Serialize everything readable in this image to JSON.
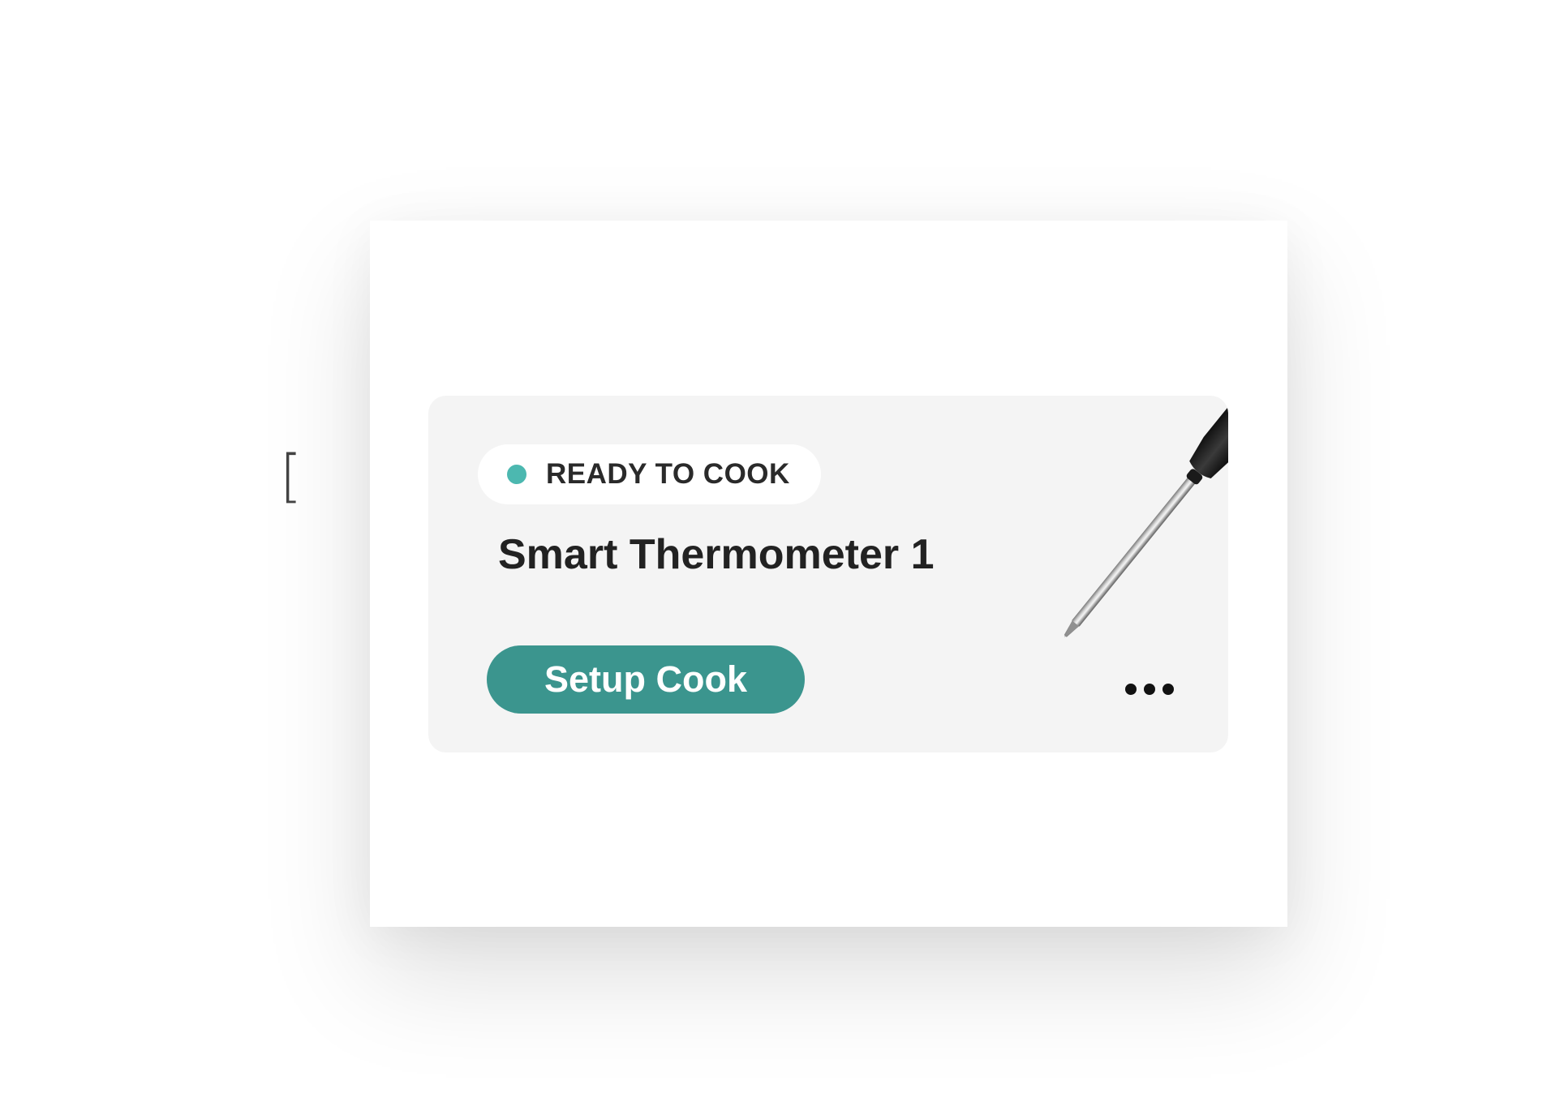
{
  "device_card": {
    "status_label": "READY TO COOK",
    "status_color": "#4cb8b0",
    "device_name": "Smart Thermometer 1",
    "setup_button_label": "Setup Cook",
    "button_color": "#3b958e",
    "more_icon": "more-horizontal-icon",
    "image": "thermometer-probe"
  },
  "side_marker": "["
}
